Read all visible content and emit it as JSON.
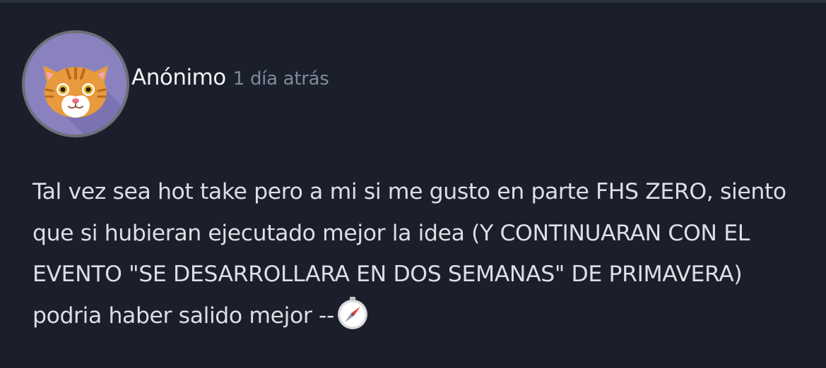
{
  "comment": {
    "author": "Anónimo",
    "timestamp": "1 día atrás",
    "avatar_icon": "cat-face-icon",
    "body": "Tal vez sea hot take pero a mi si me gusto en parte FHS ZERO, siento que si hubieran ejecutado mejor la idea (Y CONTINUARAN CON EL EVENTO \"SE DESARROLLARA EN DOS SEMANAS\" DE PRIMAVERA) podria haber salido mejor --",
    "trailing_emoji": "compass-icon"
  },
  "colors": {
    "background": "#1a1f2b",
    "avatar_bg": "#8a82bf",
    "username": "#f2f3f5",
    "timestamp": "#7f8b99",
    "body_text": "#dcdfe4"
  }
}
